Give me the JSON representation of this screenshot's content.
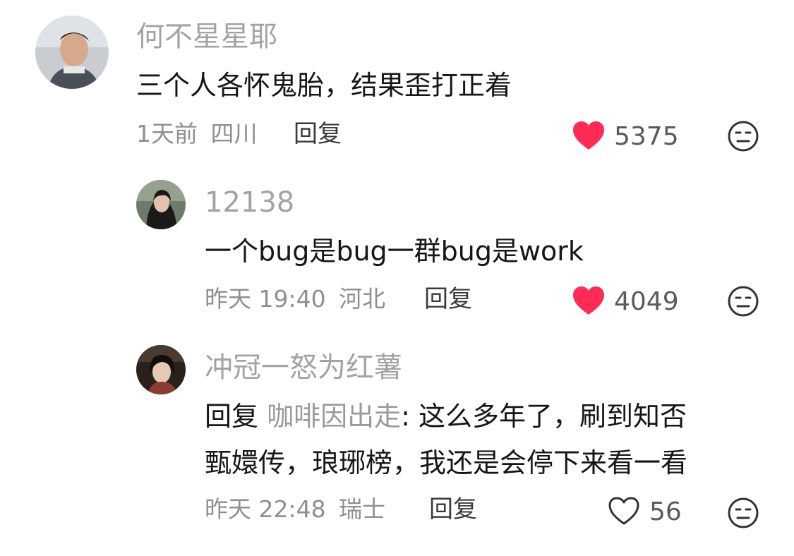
{
  "comments": [
    {
      "username": "何不星星耶",
      "text": "三个人各怀鬼胎，结果歪打正着",
      "time": "1天前",
      "location": "四川",
      "reply_label": "回复",
      "likes": "5375",
      "liked": true
    },
    {
      "username": "12138",
      "text": "一个bug是bug一群bug是work",
      "time": "昨天 19:40",
      "location": "河北",
      "reply_label": "回复",
      "likes": "4049",
      "liked": true
    },
    {
      "username": "冲冠一怒为红薯",
      "reply_prefix": "回复",
      "mention": "咖啡因出走",
      "text_line1": ": 这么多年了，刷到知否",
      "text_line2": "甄嬛传，琅琊榜，我还是会停下来看一看",
      "time": "昨天 22:48",
      "location": "瑞士",
      "reply_label": "回复",
      "likes": "56",
      "liked": false
    }
  ],
  "colors": {
    "heart_active": "#fe2c55",
    "username": "#a3a3a3",
    "meta": "#8f8f8f"
  },
  "icons": {
    "like": "heart-icon",
    "dislike": "meh-face-icon"
  }
}
